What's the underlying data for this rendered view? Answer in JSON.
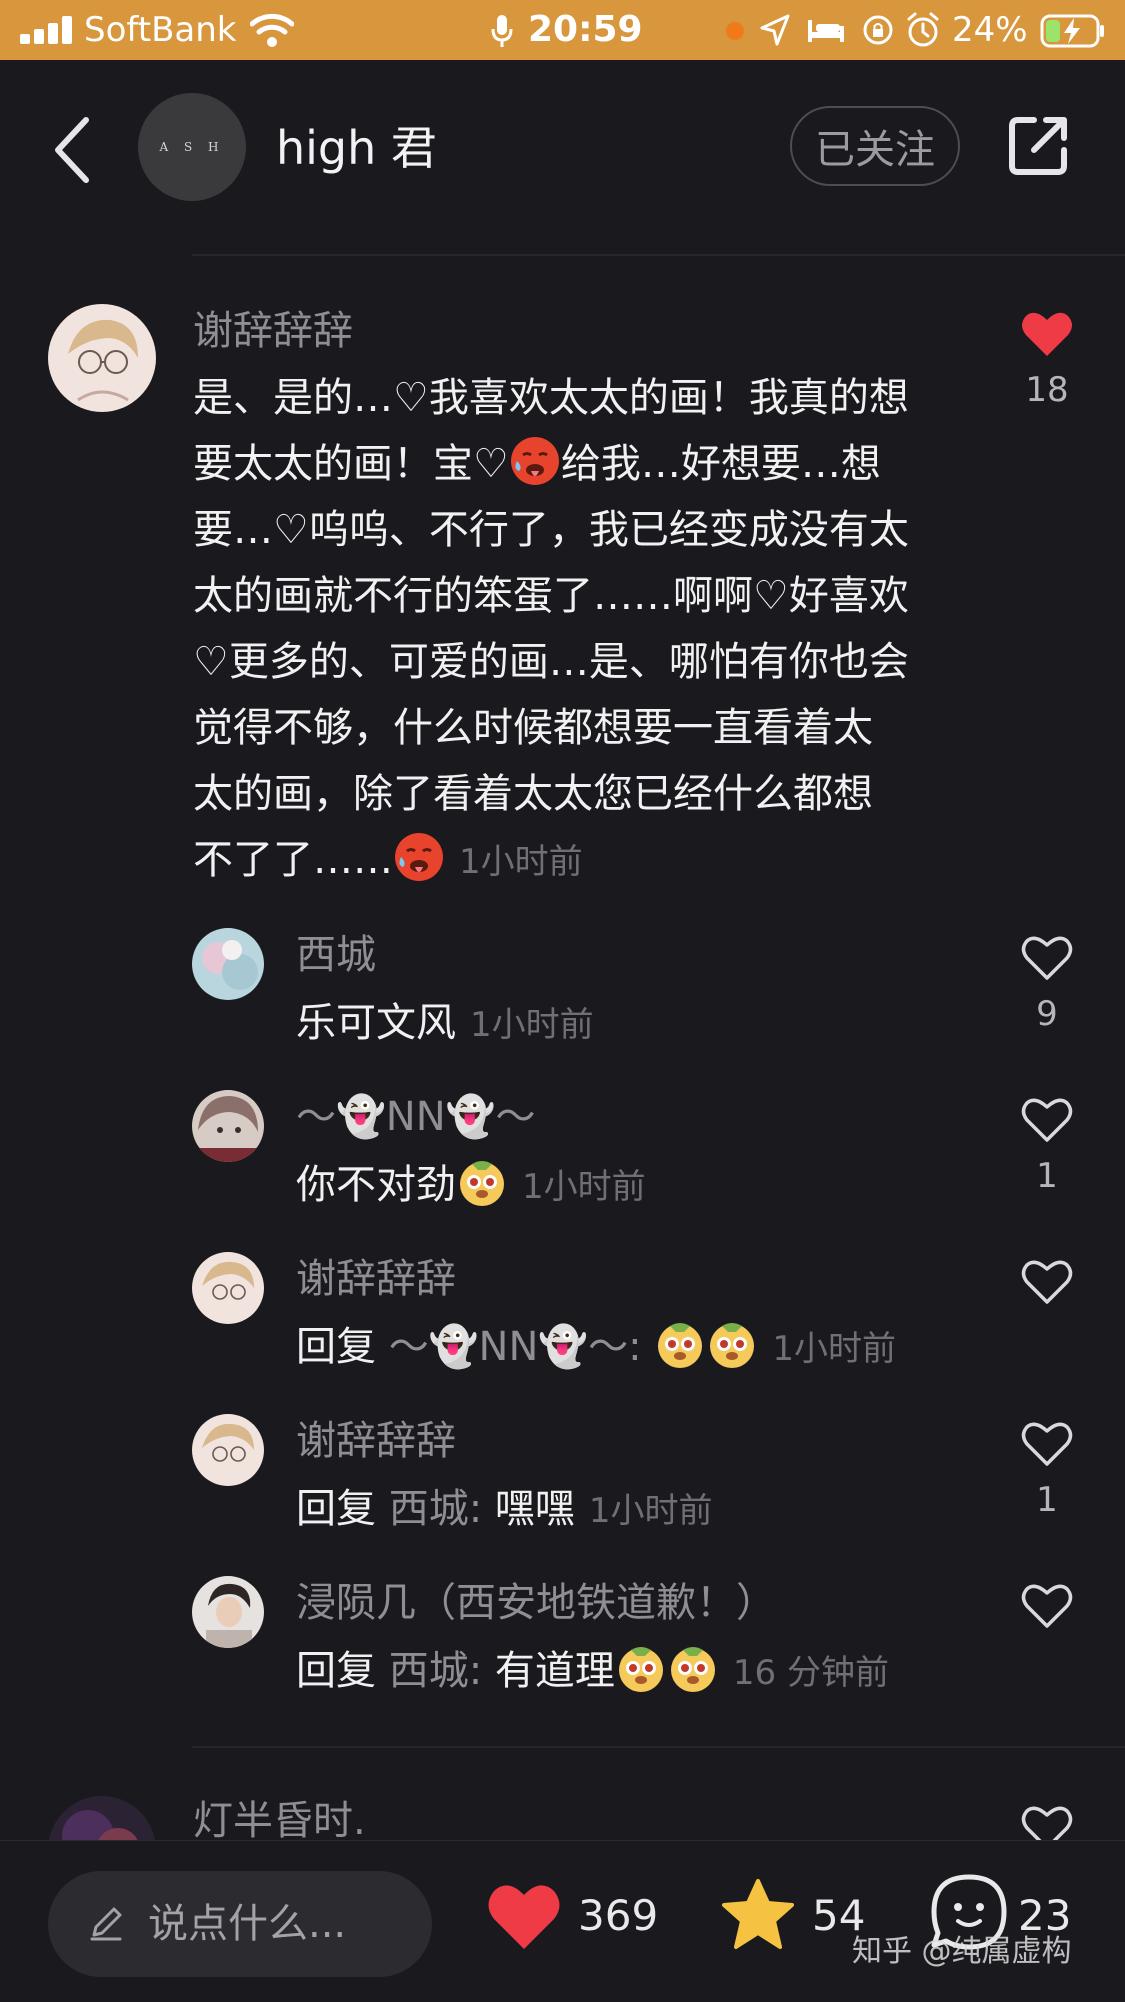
{
  "status_bar": {
    "carrier": "SoftBank",
    "time": "20:59",
    "battery": "24%",
    "background_color": "#d8963d"
  },
  "header": {
    "avatar_text": "A S H",
    "title": "high 君",
    "follow_label": "已关注",
    "icons": [
      "back-chevron-icon",
      "share-icon"
    ]
  },
  "main_comment": {
    "username": "谢辞辞辞",
    "lines": [
      "是、是的…♡我喜欢太太的画！我真的想",
      "要太太的画！宝♡",
      "给我…好想要…想",
      "要…♡呜呜、不行了，我已经变成没有太",
      "太的画就不行的笨蛋了……啊啊♡好喜欢",
      "♡更多的、可爱的画…是、哪怕有你也会",
      "觉得不够，什么时候都想要一直看着太",
      "太的画，除了看着太太您已经什么都想",
      "不了了……"
    ],
    "time": "1小时前",
    "likes": "18",
    "liked": true
  },
  "replies": [
    {
      "username": "西城",
      "prefix": "",
      "target": "",
      "text": "乐可文风",
      "time": "1小时前",
      "likes": "9"
    },
    {
      "username": "～👻NN👻～",
      "prefix": "",
      "target": "",
      "text": "你不对劲",
      "time": "1小时前",
      "likes": "1"
    },
    {
      "username": "谢辞辞辞",
      "prefix": "回复",
      "target": "～👻NN👻～:",
      "text": "",
      "time": "1小时前",
      "likes": ""
    },
    {
      "username": "谢辞辞辞",
      "prefix": "回复",
      "target": "西城:",
      "text": "嘿嘿",
      "time": "1小时前",
      "likes": "1"
    },
    {
      "username": "浸陨几（西安地铁道歉！）",
      "prefix": "回复",
      "target": "西城:",
      "text": "有道理",
      "time": "16 分钟前",
      "likes": ""
    }
  ],
  "next_comment": {
    "username": "灯半昏时."
  },
  "bottom_bar": {
    "placeholder": "说点什么...",
    "like_count": "369",
    "star_count": "54",
    "comment_count": "23"
  },
  "watermark": "知乎 @纯属虚构",
  "colors": {
    "background": "#1a1a1e",
    "like_red": "#ee3b46",
    "star_yellow": "#f5c242",
    "muted_text": "#8e8e93"
  }
}
